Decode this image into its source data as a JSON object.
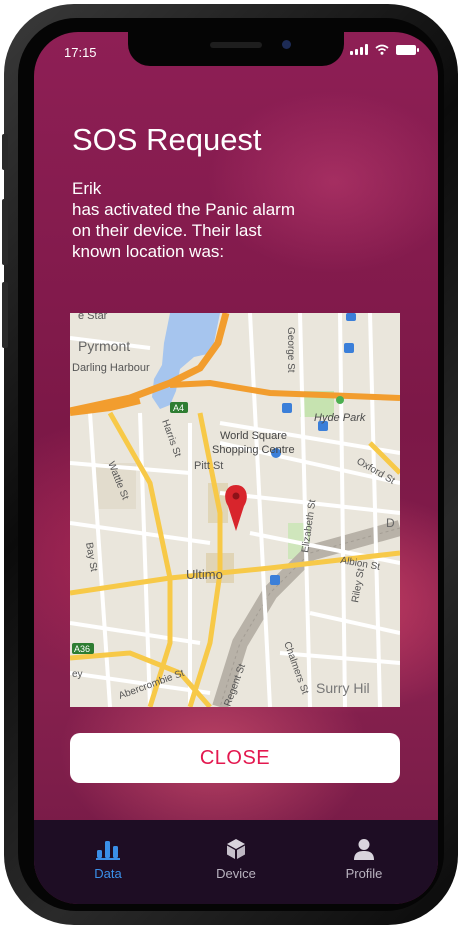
{
  "status_bar": {
    "time": "17:15"
  },
  "sos": {
    "title": "SOS Request",
    "message_lines": [
      "Erik",
      "has activated the Panic alarm",
      "on their device. Their last",
      "known location was:"
    ]
  },
  "map": {
    "labels": {
      "pyrmont": "Pyrmont",
      "darling_harbour": "Darling Harbour",
      "star": "e Star",
      "george_st": "George St",
      "hyde_park": "Hyde Park",
      "world_square_1": "World Square",
      "world_square_2": "Shopping Centre",
      "pitt_st": "Pitt St",
      "oxford_st": "Oxford St",
      "harris_st": "Harris St",
      "wattle_st": "Wattle St",
      "bay_st": "Bay St",
      "elizabeth_st": "Elizabeth St",
      "ultimo": "Ultimo",
      "albion_st": "Albion St",
      "riley_st": "Riley St",
      "chalmers_st": "Chalmers St",
      "regent_st": "Regent St",
      "abercrombie_st": "Abercrombie St",
      "surry_hills": "Surry Hil",
      "a4": "A4",
      "a36": "A36",
      "d_label": "D",
      "ey": "ey"
    }
  },
  "close_button": {
    "label": "CLOSE"
  },
  "tabs": [
    {
      "label": "Data",
      "icon": "bar-chart-icon",
      "active": true
    },
    {
      "label": "Device",
      "icon": "cube-icon",
      "active": false
    },
    {
      "label": "Profile",
      "icon": "person-icon",
      "active": false
    }
  ],
  "colors": {
    "accent": "#e3184f",
    "active_tab": "#3a8fe8",
    "tab_bar": "#1e0d24",
    "background": "#8e1f55"
  }
}
